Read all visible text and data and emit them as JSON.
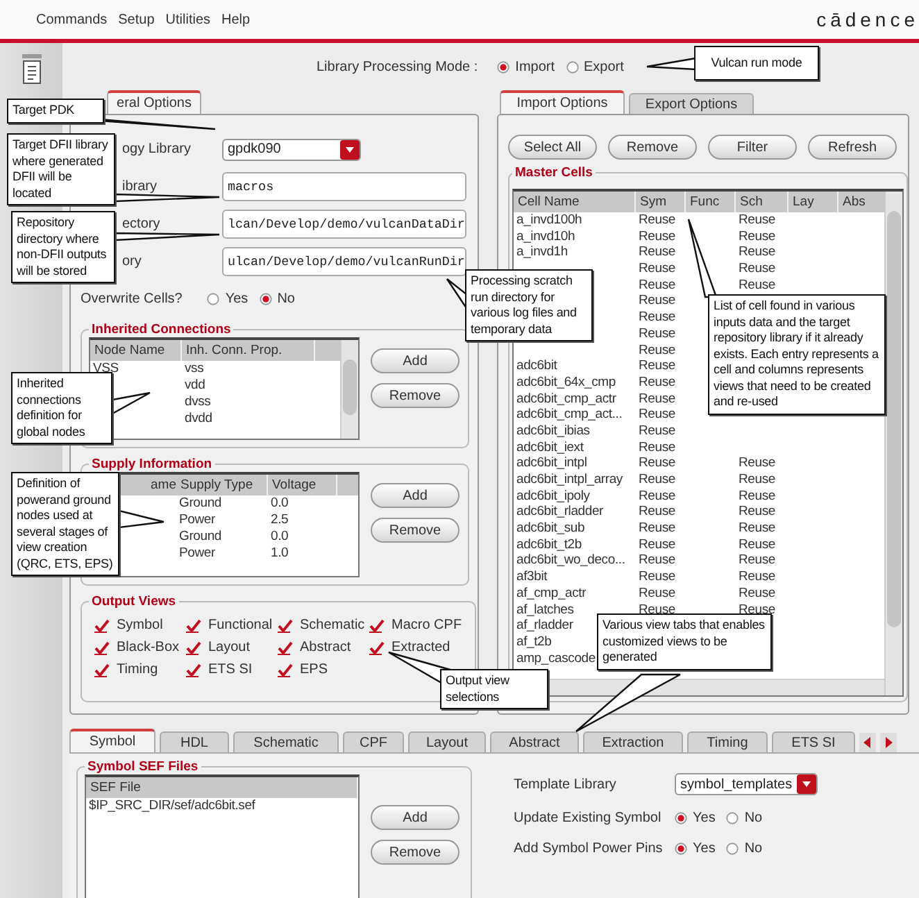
{
  "menu": [
    "Commands",
    "Setup",
    "Utilities",
    "Help"
  ],
  "brand": "cādence",
  "mode": {
    "label": "Library Processing Mode :",
    "options": [
      {
        "label": "Import",
        "selected": true
      },
      {
        "label": "Export",
        "selected": false
      }
    ]
  },
  "general_tab": {
    "label": "eral Options",
    "selected": true
  },
  "fields": [
    {
      "label": "ogy Library",
      "kind": "dropdown",
      "value": "gpdk090"
    },
    {
      "label": "ibrary",
      "kind": "text",
      "value": "macros"
    },
    {
      "label": "ectory",
      "kind": "text",
      "value": "lcan/Develop/demo/vulcanDataDir"
    },
    {
      "label": "ory",
      "kind": "text",
      "value": "ulcan/Develop/demo/vulcanRunDir"
    }
  ],
  "overwrite": {
    "label": "Overwrite Cells?",
    "options": [
      {
        "label": "Yes",
        "selected": false
      },
      {
        "label": "No",
        "selected": true
      }
    ]
  },
  "inherited": {
    "title": "Inherited Connections",
    "columns": [
      "Node Name",
      "Inh. Conn. Prop."
    ],
    "rows": [
      {
        "node": "VSS",
        "prop": "vss"
      },
      {
        "prop": "vdd"
      },
      {
        "prop": "dvss"
      },
      {
        "prop": "dvdd"
      }
    ],
    "buttons": [
      "Add",
      "Remove"
    ]
  },
  "supply": {
    "title": "Supply Information",
    "columns": [
      "ame",
      "Supply Type",
      "Voltage"
    ],
    "rows": [
      {
        "type": "Ground",
        "voltage": "0.0"
      },
      {
        "type": "Power",
        "voltage": "2.5"
      },
      {
        "type": "Ground",
        "voltage": "0.0"
      },
      {
        "type": "Power",
        "voltage": "1.0"
      }
    ],
    "buttons": [
      "Add",
      "Remove"
    ]
  },
  "output_views": {
    "title": "Output Views",
    "items": [
      {
        "label": "Symbol",
        "checked": true
      },
      {
        "label": "Functional",
        "checked": true
      },
      {
        "label": "Schematic",
        "checked": true
      },
      {
        "label": "Macro CPF",
        "checked": true
      },
      {
        "label": "Black-Box",
        "checked": true
      },
      {
        "label": "Layout",
        "checked": true
      },
      {
        "label": "Abstract",
        "checked": true
      },
      {
        "label": "Extracted",
        "checked": true
      },
      {
        "label": "Timing",
        "checked": true
      },
      {
        "label": "ETS SI",
        "checked": true
      },
      {
        "label": "EPS",
        "checked": true
      }
    ]
  },
  "option_tabs": [
    {
      "label": "Import Options",
      "selected": true
    },
    {
      "label": "Export Options",
      "selected": false
    }
  ],
  "actions": [
    "Select All",
    "Remove",
    "Filter",
    "Refresh"
  ],
  "master_cells": {
    "title": "Master Cells",
    "columns": [
      "Cell Name",
      "Sym",
      "Func",
      "Sch",
      "Lay",
      "Abs"
    ],
    "rows": [
      {
        "name": "a_invd100h",
        "sym": "Reuse",
        "sch": "Reuse"
      },
      {
        "name": "a_invd10h",
        "sym": "Reuse",
        "sch": "Reuse"
      },
      {
        "name": "a_invd1h",
        "sym": "Reuse",
        "sch": "Reuse"
      },
      {
        "sym": "Reuse",
        "sch": "Reuse"
      },
      {
        "sym": "Reuse",
        "sch": "Reuse"
      },
      {
        "sym": "Reuse"
      },
      {
        "sym": "Reuse"
      },
      {
        "sym": "Reuse"
      },
      {
        "sym": "Reuse"
      },
      {
        "name": "adc6bit",
        "sym": "Reuse"
      },
      {
        "name": "adc6bit_64x_cmp",
        "sym": "Reuse"
      },
      {
        "name": "adc6bit_cmp_actr",
        "sym": "Reuse"
      },
      {
        "name": "adc6bit_cmp_act...",
        "sym": "Reuse"
      },
      {
        "name": "adc6bit_ibias",
        "sym": "Reuse"
      },
      {
        "name": "adc6bit_iext",
        "sym": "Reuse"
      },
      {
        "name": "adc6bit_intpl",
        "sym": "Reuse",
        "sch": "Reuse"
      },
      {
        "name": "adc6bit_intpl_array",
        "sym": "Reuse",
        "sch": "Reuse"
      },
      {
        "name": "adc6bit_ipoly",
        "sym": "Reuse",
        "sch": "Reuse"
      },
      {
        "name": "adc6bit_rladder",
        "sym": "Reuse",
        "sch": "Reuse"
      },
      {
        "name": "adc6bit_sub",
        "sym": "Reuse",
        "sch": "Reuse"
      },
      {
        "name": "adc6bit_t2b",
        "sym": "Reuse",
        "sch": "Reuse"
      },
      {
        "name": "adc6bit_wo_deco...",
        "sym": "Reuse",
        "sch": "Reuse"
      },
      {
        "name": "af3bit",
        "sym": "Reuse",
        "sch": "Reuse"
      },
      {
        "name": "af_cmp_actr",
        "sym": "Reuse",
        "sch": "Reuse"
      },
      {
        "name": "af_latches",
        "sym": "Reuse",
        "sch": "Reuse"
      },
      {
        "name": "af_rladder"
      },
      {
        "name": "af_t2b"
      },
      {
        "name": "amp_cascode"
      }
    ]
  },
  "view_tabs": [
    {
      "label": "Symbol",
      "selected": true
    },
    {
      "label": "HDL",
      "selected": false
    },
    {
      "label": "Schematic",
      "selected": false
    },
    {
      "label": "CPF",
      "selected": false
    },
    {
      "label": "Layout",
      "selected": false
    },
    {
      "label": "Abstract",
      "selected": false
    },
    {
      "label": "Extraction",
      "selected": false
    },
    {
      "label": "Timing",
      "selected": false
    },
    {
      "label": "ETS SI",
      "selected": false
    }
  ],
  "sef": {
    "title": "Symbol SEF Files",
    "column": "SEF File",
    "rows": [
      "$IP_SRC_DIR/sef/adc6bit.sef"
    ],
    "buttons": [
      "Add",
      "Remove"
    ]
  },
  "template_library": {
    "label": "Template Library",
    "value": "symbol_templates"
  },
  "symbol_radios": [
    {
      "label": "Update Existing Symbol",
      "options": [
        {
          "label": "Yes",
          "selected": true
        },
        {
          "label": "No",
          "selected": false
        }
      ]
    },
    {
      "label": "Add Symbol Power Pins",
      "options": [
        {
          "label": "Yes",
          "selected": true
        },
        {
          "label": "No",
          "selected": false
        }
      ]
    }
  ],
  "callouts": [
    "Target PDK",
    "Target DFII library where generated DFII will be located",
    "Repository directory where non-DFII outputs will be stored",
    "Processing scratch run directory for various log files and temporary data",
    "Vulcan run mode",
    "List of cell found in various inputs data and the target repository library if it already exists. Each entry represents a cell and columns represents views that need to be created and re-used",
    "Inherited connections definition for global nodes",
    "Definition of powerand ground nodes used at several stages of view creation (QRC, ETS, EPS)",
    "Output view selections",
    "Various view tabs that enables customized views to be generated"
  ]
}
